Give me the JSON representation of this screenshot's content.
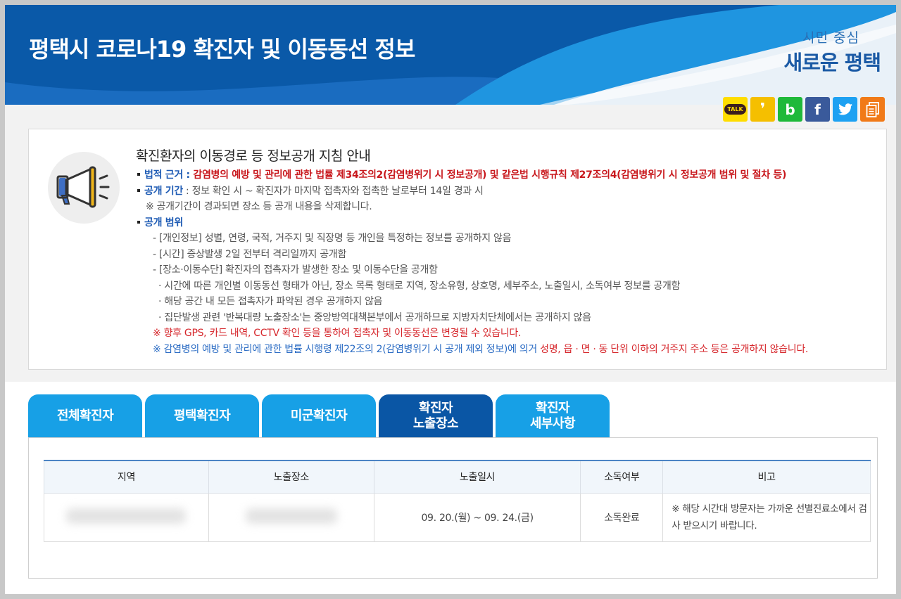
{
  "header": {
    "title": "평택시 코로나19 확진자 및 이동동선 정보",
    "slogan_top": "시민 중심",
    "slogan_main": "새로운 평택"
  },
  "share": [
    {
      "name": "kakaotalk",
      "label": "TALK",
      "color": "#ffdd00"
    },
    {
      "name": "kakaostory",
      "label": "❜",
      "color": "#f5bf00"
    },
    {
      "name": "band",
      "label": "b",
      "color": "#1fb93a"
    },
    {
      "name": "facebook",
      "label": "f",
      "color": "#3a5a9b"
    },
    {
      "name": "twitter",
      "label": "",
      "color": "#1da1f2"
    },
    {
      "name": "copy",
      "label": "",
      "color": "#f17a18"
    }
  ],
  "notice": {
    "title": "확진환자의 이동경로 등 정보공개 지침 안내",
    "law_label": "법적 근거",
    "law_text": "감염병의 예방 및 관리에 관한 법률 제34조의2(감염병위기 시 정보공개) 및 같은법 시행규칙 제27조의4(감염병위기 시 정보공개 범위 및 절차 등)",
    "period_label": "공개 기간",
    "period_text": "정보 확인 시 ~ 확진자가 마지막 접촉자와 접촉한 날로부터 14일 경과 시",
    "period_note": "※ 공개기간이 경과되면 장소 등 공개 내용을 삭제합니다.",
    "scope_label": "공개 범위",
    "scope_items": [
      "- [개인정보] 성별, 연령, 국적, 거주지 및 직장명 등 개인을 특정하는 정보를 공개하지 않음",
      "- [시간] 증상발생 2일 전부터 격리일까지 공개함",
      "- [장소·이동수단] 확진자의 접촉자가 발생한 장소 및 이동수단을 공개함"
    ],
    "scope_subitems": [
      "· 시간에 따른 개인별 이동동선 형태가 아닌, 장소 목록 형태로 지역, 장소유형, 상호명, 세부주소, 노출일시, 소독여부 정보를 공개함",
      "· 해당 공간 내 모든 접촉자가 파악된 경우 공개하지 않음",
      "· 집단발생 관련 '반복대량 노출장소'는 중앙방역대책본부에서 공개하므로 지방자치단체에서는 공개하지 않음"
    ],
    "warning": "※ 향후 GPS, 카드 내역, CCTV 확인 등을 통하여 접촉자 및 이동동선은 변경될 수 있습니다.",
    "exclude_prefix": "※ 감염병의 예방 및 관리에 관한 법률 시행령 제22조의 2(감염병위기 시 공개 제외 정보)에 의거 ",
    "exclude_red": "성명, 읍 · 면 · 동 단위 이하의 거주지 주소 등은 공개하지 않습니다."
  },
  "tabs": [
    {
      "label": "전체확진자",
      "active": false
    },
    {
      "label": "평택확진자",
      "active": false
    },
    {
      "label": "미군확진자",
      "active": false
    },
    {
      "label": "확진자\n노출장소",
      "active": true
    },
    {
      "label": "확진자\n세부사항",
      "active": false
    }
  ],
  "table": {
    "columns": [
      "지역",
      "노출장소",
      "노출일시",
      "소독여부",
      "비고"
    ],
    "rows": [
      {
        "region": "",
        "place": "",
        "datetime": "09. 20.(월) ~ 09. 24.(금)",
        "disinfection": "소독완료",
        "note": "※ 해당 시간대 방문자는 가까운 선별진료소에서 검사 받으시기 바랍니다."
      }
    ]
  }
}
